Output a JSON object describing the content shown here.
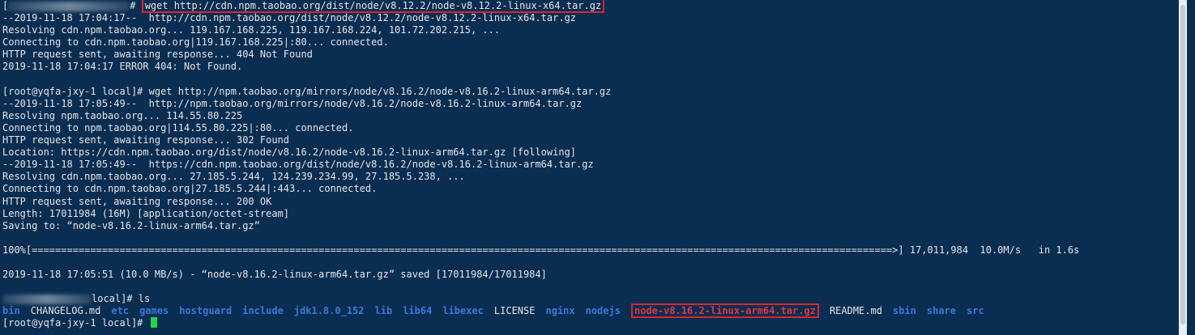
{
  "header_clip": "ls",
  "header_clip_dirs": [
    "bin",
    "CHANGELOG.md",
    "etc",
    "games",
    "hostguard",
    "include",
    "jdk1.8.0_152",
    "lib",
    "lib64",
    "libexec",
    "LICENSE",
    "nginx",
    "nodejs",
    "node-v8.16.2-linux-arm64.tar.gz",
    "README.md",
    "sbin",
    "share",
    "src"
  ],
  "lines": {
    "l0_prompt_end": "# ",
    "l0_cmd": "wget http://cdn.npm.taobao.org/dist/node/v8.12.2/node-v8.12.2-linux-x64.tar.gz",
    "l1": "--2019-11-18 17:04:17--  http://cdn.npm.taobao.org/dist/node/v8.12.2/node-v8.12.2-linux-x64.tar.gz",
    "l2": "Resolving cdn.npm.taobao.org... 119.167.168.225, 119.167.168.224, 101.72.202.215, ...",
    "l3": "Connecting to cdn.npm.taobao.org|119.167.168.225|:80... connected.",
    "l4": "HTTP request sent, awaiting response... 404 Not Found",
    "l5": "2019-11-18 17:04:17 ERROR 404: Not Found.",
    "l6": "",
    "l7": "[root@yqfa-jxy-1 local]# wget http://npm.taobao.org/mirrors/node/v8.16.2/node-v8.16.2-linux-arm64.tar.gz",
    "l8": "--2019-11-18 17:05:49--  http://npm.taobao.org/mirrors/node/v8.16.2/node-v8.16.2-linux-arm64.tar.gz",
    "l9": "Resolving npm.taobao.org... 114.55.80.225",
    "l10": "Connecting to npm.taobao.org|114.55.80.225|:80... connected.",
    "l11": "HTTP request sent, awaiting response... 302 Found",
    "l12": "Location: https://cdn.npm.taobao.org/dist/node/v8.16.2/node-v8.16.2-linux-arm64.tar.gz [following]",
    "l13": "--2019-11-18 17:05:49--  https://cdn.npm.taobao.org/dist/node/v8.16.2/node-v8.16.2-linux-arm64.tar.gz",
    "l14": "Resolving cdn.npm.taobao.org... 27.185.5.244, 124.239.234.99, 27.185.5.238, ...",
    "l15": "Connecting to cdn.npm.taobao.org|27.185.5.244|:443... connected.",
    "l16": "HTTP request sent, awaiting response... 200 OK",
    "l17": "Length: 17011984 (16M) [application/octet-stream]",
    "l18": "Saving to: “node-v8.16.2-linux-arm64.tar.gz”",
    "l19": "",
    "l20": "100%[===================================================================================================================================================>] 17,011,984  10.0M/s   in 1.6s",
    "l21": "",
    "l22": "2019-11-18 17:05:51 (10.0 MB/s) - “node-v8.16.2-linux-arm64.tar.gz” saved [17011984/17011984]",
    "l23": "",
    "l24_prompt_end": "local]# ls",
    "l26": "[root@yqfa-jxy-1 local]# "
  },
  "ls_entries": [
    {
      "name": "bin",
      "kind": "dir"
    },
    {
      "name": "CHANGELOG.md",
      "kind": "file"
    },
    {
      "name": "etc",
      "kind": "dir"
    },
    {
      "name": "games",
      "kind": "dir"
    },
    {
      "name": "hostguard",
      "kind": "dir"
    },
    {
      "name": "include",
      "kind": "dir"
    },
    {
      "name": "jdk1.8.0_152",
      "kind": "dir"
    },
    {
      "name": "lib",
      "kind": "dir"
    },
    {
      "name": "lib64",
      "kind": "dir"
    },
    {
      "name": "libexec",
      "kind": "dir"
    },
    {
      "name": "LICENSE",
      "kind": "file"
    },
    {
      "name": "nginx",
      "kind": "dir"
    },
    {
      "name": "nodejs",
      "kind": "dir"
    },
    {
      "name": "node-v8.16.2-linux-arm64.tar.gz",
      "kind": "arch"
    },
    {
      "name": "README.md",
      "kind": "file"
    },
    {
      "name": "sbin",
      "kind": "dir"
    },
    {
      "name": "share",
      "kind": "dir"
    },
    {
      "name": "src",
      "kind": "dir"
    }
  ],
  "colors": {
    "background": "#0a2d52",
    "text": "#e6e6e6",
    "directory": "#3b78d8",
    "archive": "#e0393e",
    "highlight_box": "#d8262c",
    "cursor": "#2ad14b"
  }
}
